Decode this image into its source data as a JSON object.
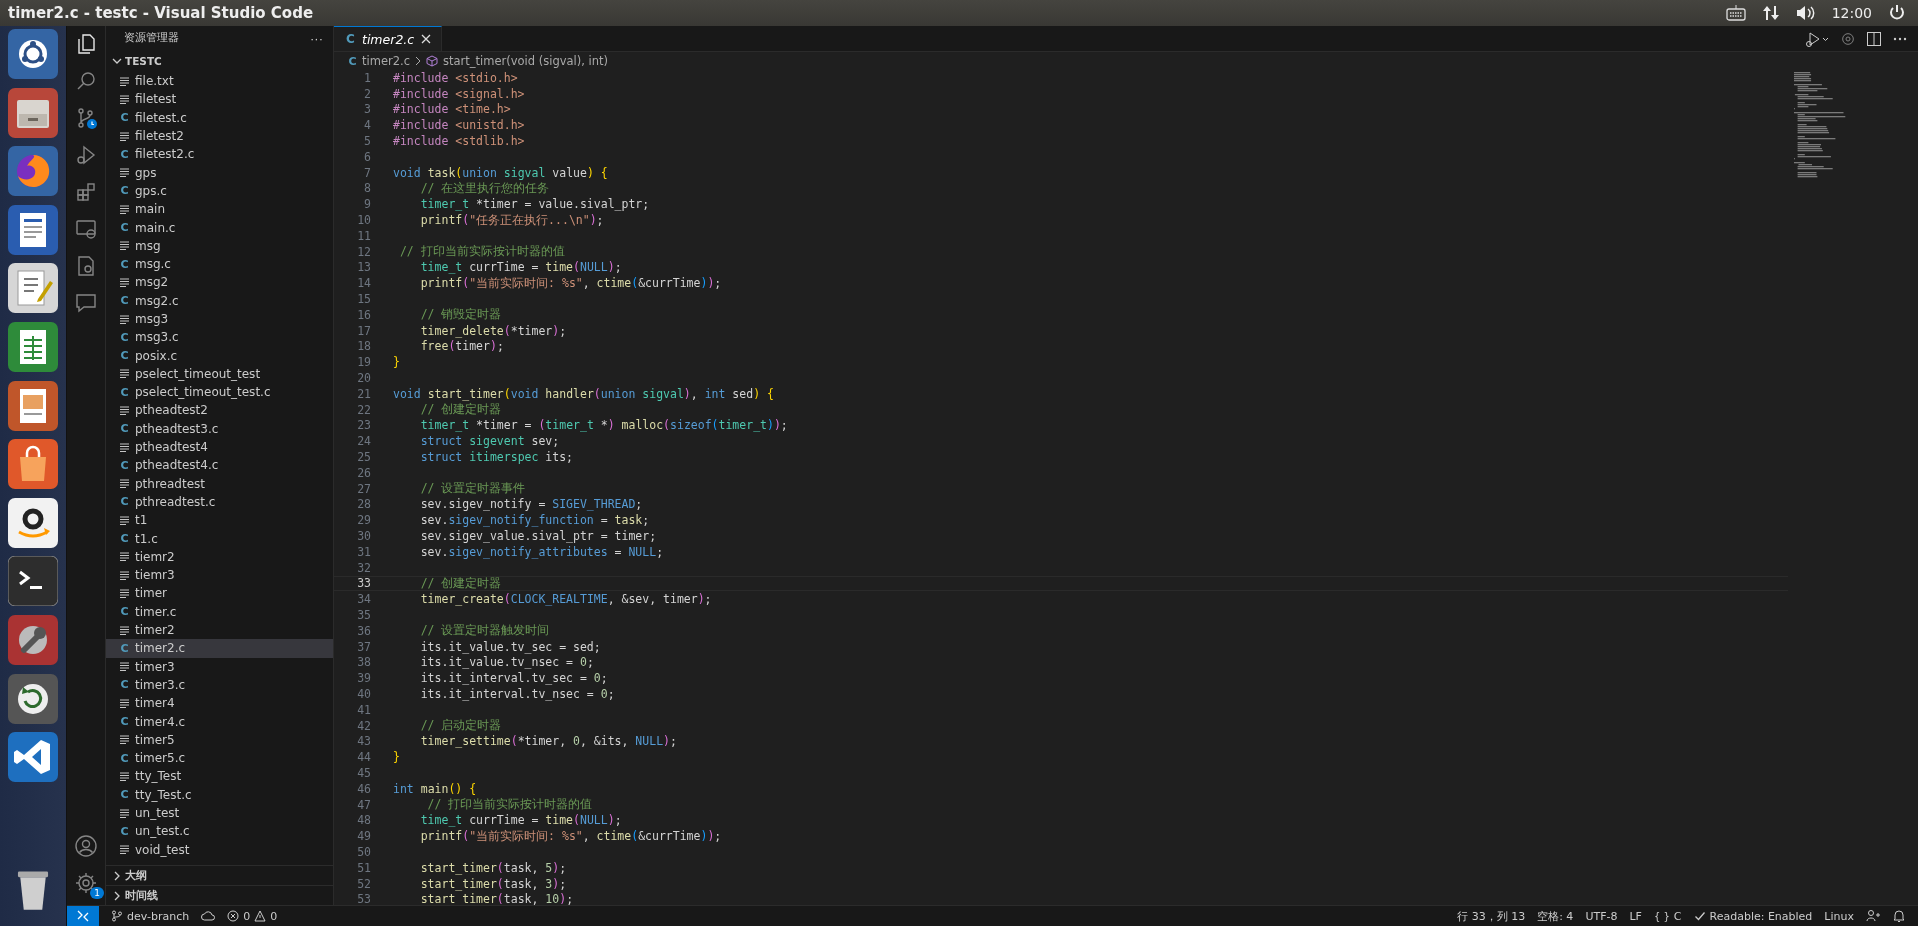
{
  "window": {
    "title": "timer2.c - testc - Visual Studio Code"
  },
  "top_panel": {
    "clock": "12:00"
  },
  "activity_bar": {
    "settings_badge": "1"
  },
  "explorer": {
    "title": "资源管理器",
    "more": "···",
    "folder": {
      "name": "TESTC",
      "expanded": true
    },
    "files": [
      {
        "name": "file.txt",
        "kind": "text",
        "selected": false
      },
      {
        "name": "filetest",
        "kind": "text",
        "selected": false
      },
      {
        "name": "filetest.c",
        "kind": "c",
        "icon": "C",
        "selected": false
      },
      {
        "name": "filetest2",
        "kind": "text",
        "selected": false
      },
      {
        "name": "filetest2.c",
        "kind": "c",
        "icon": "C",
        "selected": false
      },
      {
        "name": "gps",
        "kind": "text",
        "selected": false
      },
      {
        "name": "gps.c",
        "kind": "c",
        "icon": "C",
        "selected": false
      },
      {
        "name": "main",
        "kind": "text",
        "selected": false
      },
      {
        "name": "main.c",
        "kind": "c",
        "icon": "C",
        "selected": false
      },
      {
        "name": "msg",
        "kind": "text",
        "selected": false
      },
      {
        "name": "msg.c",
        "kind": "c",
        "icon": "C",
        "selected": false
      },
      {
        "name": "msg2",
        "kind": "text",
        "selected": false
      },
      {
        "name": "msg2.c",
        "kind": "c",
        "icon": "C",
        "selected": false
      },
      {
        "name": "msg3",
        "kind": "text",
        "selected": false
      },
      {
        "name": "msg3.c",
        "kind": "c",
        "icon": "C",
        "selected": false
      },
      {
        "name": "posix.c",
        "kind": "c",
        "icon": "C",
        "selected": false
      },
      {
        "name": "pselect_timeout_test",
        "kind": "text",
        "selected": false
      },
      {
        "name": "pselect_timeout_test.c",
        "kind": "c",
        "icon": "C",
        "selected": false
      },
      {
        "name": "ptheadtest2",
        "kind": "text",
        "selected": false
      },
      {
        "name": "ptheadtest3.c",
        "kind": "c",
        "icon": "C",
        "selected": false
      },
      {
        "name": "ptheadtest4",
        "kind": "text",
        "selected": false
      },
      {
        "name": "ptheadtest4.c",
        "kind": "c",
        "icon": "C",
        "selected": false
      },
      {
        "name": "pthreadtest",
        "kind": "text",
        "selected": false
      },
      {
        "name": "pthreadtest.c",
        "kind": "c",
        "icon": "C",
        "selected": false
      },
      {
        "name": "t1",
        "kind": "text",
        "selected": false
      },
      {
        "name": "t1.c",
        "kind": "c",
        "icon": "C",
        "selected": false
      },
      {
        "name": "tiemr2",
        "kind": "text",
        "selected": false
      },
      {
        "name": "tiemr3",
        "kind": "text",
        "selected": false
      },
      {
        "name": "timer",
        "kind": "text",
        "selected": false
      },
      {
        "name": "timer.c",
        "kind": "c",
        "icon": "C",
        "selected": false
      },
      {
        "name": "timer2",
        "kind": "text",
        "selected": false
      },
      {
        "name": "timer2.c",
        "kind": "c",
        "icon": "C",
        "selected": true
      },
      {
        "name": "timer3",
        "kind": "text",
        "selected": false
      },
      {
        "name": "timer3.c",
        "kind": "c",
        "icon": "C",
        "selected": false
      },
      {
        "name": "timer4",
        "kind": "text",
        "selected": false
      },
      {
        "name": "timer4.c",
        "kind": "c",
        "icon": "C",
        "selected": false
      },
      {
        "name": "timer5",
        "kind": "text",
        "selected": false
      },
      {
        "name": "timer5.c",
        "kind": "c",
        "icon": "C",
        "selected": false
      },
      {
        "name": "tty_Test",
        "kind": "text",
        "selected": false
      },
      {
        "name": "tty_Test.c",
        "kind": "c",
        "icon": "C",
        "selected": false
      },
      {
        "name": "un_test",
        "kind": "text",
        "selected": false
      },
      {
        "name": "un_test.c",
        "kind": "c",
        "icon": "C",
        "selected": false
      },
      {
        "name": "void_test",
        "kind": "text",
        "selected": false
      }
    ],
    "sections": [
      {
        "name": "大纲",
        "expanded": false
      },
      {
        "name": "时间线",
        "expanded": false
      }
    ]
  },
  "editor": {
    "tabs": [
      {
        "label": "timer2.c",
        "icon": "C",
        "selected": true
      }
    ],
    "breadcrumb": {
      "icon": "C",
      "file": "timer2.c",
      "symbol": "start_timer(void (sigval), int)"
    },
    "lines": [
      {
        "no": "1",
        "active": false,
        "tokens": [
          {
            "kind": "directive",
            "text": "#include "
          },
          {
            "kind": "string",
            "text": "<stdio.h>"
          }
        ]
      },
      {
        "no": "2",
        "active": false,
        "tokens": [
          {
            "kind": "directive",
            "text": "#include "
          },
          {
            "kind": "string",
            "text": "<signal.h>"
          }
        ]
      },
      {
        "no": "3",
        "active": false,
        "tokens": [
          {
            "kind": "directive",
            "text": "#include "
          },
          {
            "kind": "string",
            "text": "<time.h>"
          }
        ]
      },
      {
        "no": "4",
        "active": false,
        "tokens": [
          {
            "kind": "directive",
            "text": "#include "
          },
          {
            "kind": "string",
            "text": "<unistd.h>"
          }
        ]
      },
      {
        "no": "5",
        "active": false,
        "tokens": [
          {
            "kind": "directive",
            "text": "#include "
          },
          {
            "kind": "string",
            "text": "<stdlib.h>"
          }
        ]
      },
      {
        "no": "6",
        "active": false
      },
      {
        "no": "7",
        "active": false,
        "tokens": [
          {
            "kind": "keyword",
            "text": "void "
          },
          {
            "kind": "function",
            "text": "task"
          },
          {
            "kind": "bracket1",
            "text": "("
          },
          {
            "kind": "keyword",
            "text": "union "
          },
          {
            "kind": "type",
            "text": "sigval"
          },
          {
            "kind": "plain",
            "text": " value"
          },
          {
            "kind": "bracket1",
            "text": ") {"
          }
        ]
      },
      {
        "no": "8",
        "active": false,
        "tokens": [
          {
            "kind": "comment",
            "text": "    // 在这里执行您的任务"
          }
        ]
      },
      {
        "no": "9",
        "active": false,
        "tokens": [
          {
            "kind": "type",
            "text": "    timer_t"
          },
          {
            "kind": "plain",
            "text": " *timer = value.sival_ptr;"
          }
        ]
      },
      {
        "no": "10",
        "active": false,
        "tokens": [
          {
            "kind": "function",
            "text": "    printf"
          },
          {
            "kind": "bracket2",
            "text": "("
          },
          {
            "kind": "string",
            "text": "\"任务正在执行...\\n\""
          },
          {
            "kind": "bracket2",
            "text": ")"
          },
          {
            "kind": "plain",
            "text": ";"
          }
        ]
      },
      {
        "no": "11",
        "active": false
      },
      {
        "no": "12",
        "active": false,
        "tokens": [
          {
            "kind": "comment",
            "text": " // 打印当前实际按计时器的值"
          }
        ]
      },
      {
        "no": "13",
        "active": false,
        "tokens": [
          {
            "kind": "type",
            "text": "    time_t"
          },
          {
            "kind": "plain",
            "text": " currTime = "
          },
          {
            "kind": "function",
            "text": "time"
          },
          {
            "kind": "bracket2",
            "text": "("
          },
          {
            "kind": "keyword",
            "text": "NULL"
          },
          {
            "kind": "bracket2",
            "text": ")"
          },
          {
            "kind": "plain",
            "text": ";"
          }
        ]
      },
      {
        "no": "14",
        "active": false,
        "tokens": [
          {
            "kind": "function",
            "text": "    printf"
          },
          {
            "kind": "bracket2",
            "text": "("
          },
          {
            "kind": "string",
            "text": "\"当前实际时间: %s\""
          },
          {
            "kind": "plain",
            "text": ", "
          },
          {
            "kind": "function",
            "text": "ctime"
          },
          {
            "kind": "bracket3",
            "text": "("
          },
          {
            "kind": "plain",
            "text": "&currTime"
          },
          {
            "kind": "bracket3",
            "text": ")"
          },
          {
            "kind": "bracket2",
            "text": ")"
          },
          {
            "kind": "plain",
            "text": ";"
          }
        ]
      },
      {
        "no": "15",
        "active": false
      },
      {
        "no": "16",
        "active": false,
        "tokens": [
          {
            "kind": "comment",
            "text": "    // 销毁定时器"
          }
        ]
      },
      {
        "no": "17",
        "active": false,
        "tokens": [
          {
            "kind": "function",
            "text": "    timer_delete"
          },
          {
            "kind": "bracket2",
            "text": "("
          },
          {
            "kind": "plain",
            "text": "*timer"
          },
          {
            "kind": "bracket2",
            "text": ")"
          },
          {
            "kind": "plain",
            "text": ";"
          }
        ]
      },
      {
        "no": "18",
        "active": false,
        "tokens": [
          {
            "kind": "function",
            "text": "    free"
          },
          {
            "kind": "bracket2",
            "text": "("
          },
          {
            "kind": "plain",
            "text": "timer"
          },
          {
            "kind": "bracket2",
            "text": ")"
          },
          {
            "kind": "plain",
            "text": ";"
          }
        ]
      },
      {
        "no": "19",
        "active": false,
        "tokens": [
          {
            "kind": "bracket1",
            "text": "}"
          }
        ]
      },
      {
        "no": "20",
        "active": false
      },
      {
        "no": "21",
        "active": false,
        "tokens": [
          {
            "kind": "keyword",
            "text": "void "
          },
          {
            "kind": "function",
            "text": "start_timer"
          },
          {
            "kind": "bracket1",
            "text": "("
          },
          {
            "kind": "keyword",
            "text": "void "
          },
          {
            "kind": "function",
            "text": "handler"
          },
          {
            "kind": "bracket2",
            "text": "("
          },
          {
            "kind": "keyword",
            "text": "union "
          },
          {
            "kind": "type",
            "text": "sigval"
          },
          {
            "kind": "bracket2",
            "text": ")"
          },
          {
            "kind": "plain",
            "text": ", "
          },
          {
            "kind": "keyword",
            "text": "int"
          },
          {
            "kind": "plain",
            "text": " sed"
          },
          {
            "kind": "bracket1",
            "text": ") {"
          }
        ]
      },
      {
        "no": "22",
        "active": false,
        "tokens": [
          {
            "kind": "comment",
            "text": "    // 创建定时器"
          }
        ]
      },
      {
        "no": "23",
        "active": false,
        "tokens": [
          {
            "kind": "type",
            "text": "    timer_t"
          },
          {
            "kind": "plain",
            "text": " *timer = "
          },
          {
            "kind": "bracket2",
            "text": "("
          },
          {
            "kind": "type",
            "text": "timer_t"
          },
          {
            "kind": "plain",
            "text": " *"
          },
          {
            "kind": "bracket2",
            "text": ")"
          },
          {
            "kind": "function",
            "text": " malloc"
          },
          {
            "kind": "bracket2",
            "text": "("
          },
          {
            "kind": "keyword",
            "text": "sizeof"
          },
          {
            "kind": "bracket3",
            "text": "("
          },
          {
            "kind": "type",
            "text": "timer_t"
          },
          {
            "kind": "bracket3",
            "text": ")"
          },
          {
            "kind": "bracket2",
            "text": ")"
          },
          {
            "kind": "plain",
            "text": ";"
          }
        ]
      },
      {
        "no": "24",
        "active": false,
        "tokens": [
          {
            "kind": "keyword",
            "text": "    struct "
          },
          {
            "kind": "type",
            "text": "sigevent"
          },
          {
            "kind": "plain",
            "text": " sev;"
          }
        ]
      },
      {
        "no": "25",
        "active": false,
        "tokens": [
          {
            "kind": "keyword",
            "text": "    struct "
          },
          {
            "kind": "type",
            "text": "itimerspec"
          },
          {
            "kind": "plain",
            "text": " its;"
          }
        ]
      },
      {
        "no": "26",
        "active": false
      },
      {
        "no": "27",
        "active": false,
        "tokens": [
          {
            "kind": "comment",
            "text": "    // 设置定时器事件"
          }
        ]
      },
      {
        "no": "28",
        "active": false,
        "tokens": [
          {
            "kind": "plain",
            "text": "    sev.sigev_notify = "
          },
          {
            "kind": "keyword",
            "text": "SIGEV_THREAD"
          },
          {
            "kind": "plain",
            "text": ";"
          }
        ]
      },
      {
        "no": "29",
        "active": false,
        "tokens": [
          {
            "kind": "plain",
            "text": "    sev."
          },
          {
            "kind": "keyword",
            "text": "sigev_notify_function"
          },
          {
            "kind": "plain",
            "text": " = "
          },
          {
            "kind": "function",
            "text": "task"
          },
          {
            "kind": "plain",
            "text": ";"
          }
        ]
      },
      {
        "no": "30",
        "active": false,
        "tokens": [
          {
            "kind": "plain",
            "text": "    sev.sigev_value.sival_ptr = timer;"
          }
        ]
      },
      {
        "no": "31",
        "active": false,
        "tokens": [
          {
            "kind": "plain",
            "text": "    sev."
          },
          {
            "kind": "keyword",
            "text": "sigev_notify_attributes"
          },
          {
            "kind": "plain",
            "text": " = "
          },
          {
            "kind": "keyword",
            "text": "NULL"
          },
          {
            "kind": "plain",
            "text": ";"
          }
        ]
      },
      {
        "no": "32",
        "active": false
      },
      {
        "no": "33",
        "active": true,
        "tokens": [
          {
            "kind": "comment",
            "text": "    // 创建定时器"
          }
        ]
      },
      {
        "no": "34",
        "active": false,
        "tokens": [
          {
            "kind": "function",
            "text": "    timer_create"
          },
          {
            "kind": "bracket2",
            "text": "("
          },
          {
            "kind": "keyword",
            "text": "CLOCK_REALTIME"
          },
          {
            "kind": "plain",
            "text": ", &sev, timer"
          },
          {
            "kind": "bracket2",
            "text": ")"
          },
          {
            "kind": "plain",
            "text": ";"
          }
        ]
      },
      {
        "no": "35",
        "active": false
      },
      {
        "no": "36",
        "active": false,
        "tokens": [
          {
            "kind": "comment",
            "text": "    // 设置定时器触发时间"
          }
        ]
      },
      {
        "no": "37",
        "active": false,
        "tokens": [
          {
            "kind": "plain",
            "text": "    its.it_value.tv_sec = sed;"
          }
        ]
      },
      {
        "no": "38",
        "active": false,
        "tokens": [
          {
            "kind": "plain",
            "text": "    its.it_value.tv_nsec = "
          },
          {
            "kind": "number",
            "text": "0"
          },
          {
            "kind": "plain",
            "text": ";"
          }
        ]
      },
      {
        "no": "39",
        "active": false,
        "tokens": [
          {
            "kind": "plain",
            "text": "    its.it_interval.tv_sec = "
          },
          {
            "kind": "number",
            "text": "0"
          },
          {
            "kind": "plain",
            "text": ";"
          }
        ]
      },
      {
        "no": "40",
        "active": false,
        "tokens": [
          {
            "kind": "plain",
            "text": "    its.it_interval.tv_nsec = "
          },
          {
            "kind": "number",
            "text": "0"
          },
          {
            "kind": "plain",
            "text": ";"
          }
        ]
      },
      {
        "no": "41",
        "active": false
      },
      {
        "no": "42",
        "active": false,
        "tokens": [
          {
            "kind": "comment",
            "text": "    // 启动定时器"
          }
        ]
      },
      {
        "no": "43",
        "active": false,
        "tokens": [
          {
            "kind": "function",
            "text": "    timer_settime"
          },
          {
            "kind": "bracket2",
            "text": "("
          },
          {
            "kind": "plain",
            "text": "*timer, "
          },
          {
            "kind": "number",
            "text": "0"
          },
          {
            "kind": "plain",
            "text": ", &its, "
          },
          {
            "kind": "keyword",
            "text": "NULL"
          },
          {
            "kind": "bracket2",
            "text": ")"
          },
          {
            "kind": "plain",
            "text": ";"
          }
        ]
      },
      {
        "no": "44",
        "active": false,
        "tokens": [
          {
            "kind": "bracket1",
            "text": "}"
          }
        ]
      },
      {
        "no": "45",
        "active": false
      },
      {
        "no": "46",
        "active": false,
        "tokens": [
          {
            "kind": "keyword",
            "text": "int "
          },
          {
            "kind": "function",
            "text": "main"
          },
          {
            "kind": "bracket1",
            "text": "() {"
          }
        ]
      },
      {
        "no": "47",
        "active": false,
        "tokens": [
          {
            "kind": "comment",
            "text": "     // 打印当前实际按计时器的值"
          }
        ]
      },
      {
        "no": "48",
        "active": false,
        "tokens": [
          {
            "kind": "type",
            "text": "    time_t"
          },
          {
            "kind": "plain",
            "text": " currTime = "
          },
          {
            "kind": "function",
            "text": "time"
          },
          {
            "kind": "bracket2",
            "text": "("
          },
          {
            "kind": "keyword",
            "text": "NULL"
          },
          {
            "kind": "bracket2",
            "text": ")"
          },
          {
            "kind": "plain",
            "text": ";"
          }
        ]
      },
      {
        "no": "49",
        "active": false,
        "tokens": [
          {
            "kind": "function",
            "text": "    printf"
          },
          {
            "kind": "bracket2",
            "text": "("
          },
          {
            "kind": "string",
            "text": "\"当前实际时间: %s\""
          },
          {
            "kind": "plain",
            "text": ", "
          },
          {
            "kind": "function",
            "text": "ctime"
          },
          {
            "kind": "bracket3",
            "text": "("
          },
          {
            "kind": "plain",
            "text": "&currTime"
          },
          {
            "kind": "bracket3",
            "text": ")"
          },
          {
            "kind": "bracket2",
            "text": ")"
          },
          {
            "kind": "plain",
            "text": ";"
          }
        ]
      },
      {
        "no": "50",
        "active": false
      },
      {
        "no": "51",
        "active": false,
        "tokens": [
          {
            "kind": "function",
            "text": "    start_timer"
          },
          {
            "kind": "bracket2",
            "text": "("
          },
          {
            "kind": "plain",
            "text": "task, "
          },
          {
            "kind": "number",
            "text": "5"
          },
          {
            "kind": "bracket2",
            "text": ")"
          },
          {
            "kind": "plain",
            "text": ";"
          }
        ]
      },
      {
        "no": "52",
        "active": false,
        "tokens": [
          {
            "kind": "function",
            "text": "    start_timer"
          },
          {
            "kind": "bracket2",
            "text": "("
          },
          {
            "kind": "plain",
            "text": "task, "
          },
          {
            "kind": "number",
            "text": "3"
          },
          {
            "kind": "bracket2",
            "text": ")"
          },
          {
            "kind": "plain",
            "text": ";"
          }
        ]
      },
      {
        "no": "53",
        "active": false,
        "tokens": [
          {
            "kind": "function",
            "text": "    start_timer"
          },
          {
            "kind": "bracket2",
            "text": "("
          },
          {
            "kind": "plain",
            "text": "task, "
          },
          {
            "kind": "number",
            "text": "10"
          },
          {
            "kind": "bracket2",
            "text": ")"
          },
          {
            "kind": "plain",
            "text": ";"
          }
        ]
      }
    ]
  },
  "status_bar": {
    "branch": "dev-branch",
    "errors": "0",
    "warnings": "0",
    "position": "行 33，列 13",
    "indent": "空格: 4",
    "encoding": "UTF-8",
    "eol": "LF",
    "language_braces": "{ }",
    "language": "C",
    "linter": "Readable: Enabled",
    "os": "Linux"
  }
}
